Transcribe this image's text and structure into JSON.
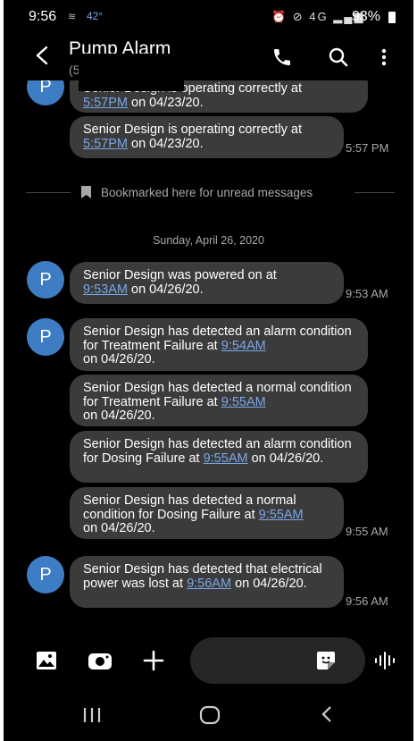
{
  "status_bar": {
    "time": "9:56",
    "temperature": "42°",
    "battery": "93%"
  },
  "header": {
    "title": "Pump Alarm",
    "subtitle": "(5"
  },
  "divider": {
    "bookmark_text": "Bookmarked here for unread messages"
  },
  "date_separator": "Sunday, April 26, 2020",
  "avatar_letter": "P",
  "messages": [
    {
      "pre": "Senior Design is operating correctly at",
      "link": "5:57PM",
      "post": " on 04/23/20.",
      "time": ""
    },
    {
      "pre": "Senior Design is operating correctly at",
      "link": "5:57PM",
      "post": " on 04/23/20.",
      "time": "5:57 PM"
    },
    {
      "pre": "Senior Design was powered on at",
      "link": "9:53AM",
      "post": " on 04/26/20.",
      "time": "9:53 AM"
    },
    {
      "pre": "Senior Design has detected an alarm condition for Treatment Failure at ",
      "link": "9:54AM",
      "post": "on 04/26/20.",
      "time": ""
    },
    {
      "pre": "Senior Design has detected a normal condition for Treatment Failure at ",
      "link": "9:55AM",
      "post": "on 04/26/20.",
      "time": ""
    },
    {
      "pre": "Senior Design has detected an alarm condition for Dosing Failure at ",
      "link": "9:55AM",
      "post": " on 04/26/20.",
      "time": ""
    },
    {
      "pre": "Senior Design has detected a normal condition for Dosing Failure at ",
      "link": "9:55AM",
      "post": "on 04/26/20.",
      "time": "9:55 AM"
    },
    {
      "pre": "Senior Design has detected that electrical power was lost at ",
      "link": "9:56AM",
      "post": " on 04/26/20.",
      "time": "9:56 AM"
    }
  ],
  "composer": {
    "placeholder": ""
  },
  "colors": {
    "background": "#000000",
    "bubble": "#3b3b3b",
    "avatar": "#3e7dc4",
    "link": "#7aa7e8",
    "secondary_text": "#a8a8a8"
  },
  "icons": [
    "back-arrow-icon",
    "phone-icon",
    "search-icon",
    "more-vertical-icon",
    "bookmark-icon",
    "gallery-icon",
    "camera-icon",
    "plus-icon",
    "sticker-icon",
    "voice-icon",
    "recents-icon",
    "home-icon",
    "nav-back-icon"
  ]
}
